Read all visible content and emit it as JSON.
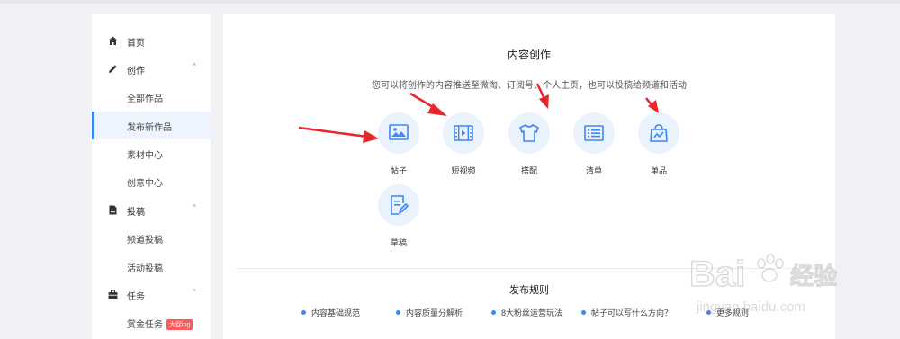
{
  "sidebar": {
    "items": [
      {
        "label": "首页",
        "icon": "home-icon",
        "type": "group",
        "chevron": ""
      },
      {
        "label": "创作",
        "icon": "pencil-icon",
        "type": "group",
        "chevron": "^"
      },
      {
        "label": "全部作品",
        "type": "sub"
      },
      {
        "label": "发布新作品",
        "type": "sub",
        "active": true
      },
      {
        "label": "素材中心",
        "type": "sub"
      },
      {
        "label": "创意中心",
        "type": "sub"
      },
      {
        "label": "投稿",
        "icon": "document-icon",
        "type": "group",
        "chevron": "^"
      },
      {
        "label": "频道投稿",
        "type": "sub"
      },
      {
        "label": "活动投稿",
        "type": "sub"
      },
      {
        "label": "任务",
        "icon": "briefcase-icon",
        "type": "group",
        "chevron": "^"
      },
      {
        "label": "赏金任务",
        "type": "sub",
        "badge": "大促ing"
      }
    ]
  },
  "main": {
    "title": "内容创作",
    "subtitle": "您可以将创作的内容推送至微淘、订阅号、个人主页，也可以投稿给频道和活动",
    "content_types": [
      {
        "label": "帖子",
        "icon": "image-icon"
      },
      {
        "label": "短视频",
        "icon": "film-icon"
      },
      {
        "label": "搭配",
        "icon": "tshirt-icon"
      },
      {
        "label": "清单",
        "icon": "list-icon"
      },
      {
        "label": "单品",
        "icon": "shopping-bag-icon"
      },
      {
        "label": "草稿",
        "icon": "draft-icon"
      }
    ],
    "rules_title": "发布规则",
    "rules": [
      "内容基础规范",
      "内容质量分解析",
      "8大粉丝运营玩法",
      "帖子可以写什么方向？",
      "更多规则"
    ]
  },
  "watermark": {
    "brand": "Baidu经验",
    "url": "jingyan.baidu.com"
  },
  "colors": {
    "accent": "#3d86f5",
    "icon_bg": "#e9f2fd",
    "arrow": "#e8262b",
    "page_bg": "#f1f2f5"
  }
}
